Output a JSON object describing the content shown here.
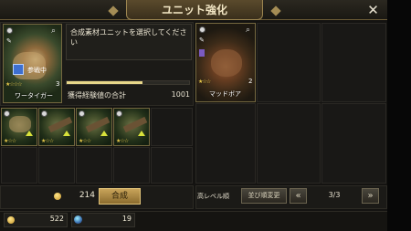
{
  "header": {
    "title": "ユニット強化",
    "close_icon": "close-icon"
  },
  "base_unit": {
    "name": "ワータイガー",
    "status": "参戦中",
    "level": "3",
    "stars": "★☆☆☆"
  },
  "info_panel": {
    "message": "合成素材ユニットを選択してください",
    "exp_label": "獲得経験値の合計",
    "exp_value": "1001",
    "exp_progress": 0.62
  },
  "materials": [
    {
      "name": "",
      "stars": "★☆☆"
    },
    {
      "name": "",
      "stars": "★☆☆"
    },
    {
      "name": "",
      "stars": "★☆☆"
    },
    {
      "name": "",
      "stars": "★☆☆"
    }
  ],
  "list_units": [
    {
      "name": "マッドボア",
      "level": "2",
      "stars": "★☆☆"
    }
  ],
  "synthesis": {
    "cost": "214",
    "button_label": "合成"
  },
  "sort_bar": {
    "sort_label": "高レベル順",
    "order_button": "並び順変更",
    "page": "3/3"
  },
  "footer": {
    "gold": "522",
    "gems": "19"
  },
  "colors": {
    "accent": "#c9a45a",
    "frame_gold": "#9c8550",
    "exp_bar": "#e8d78a"
  }
}
